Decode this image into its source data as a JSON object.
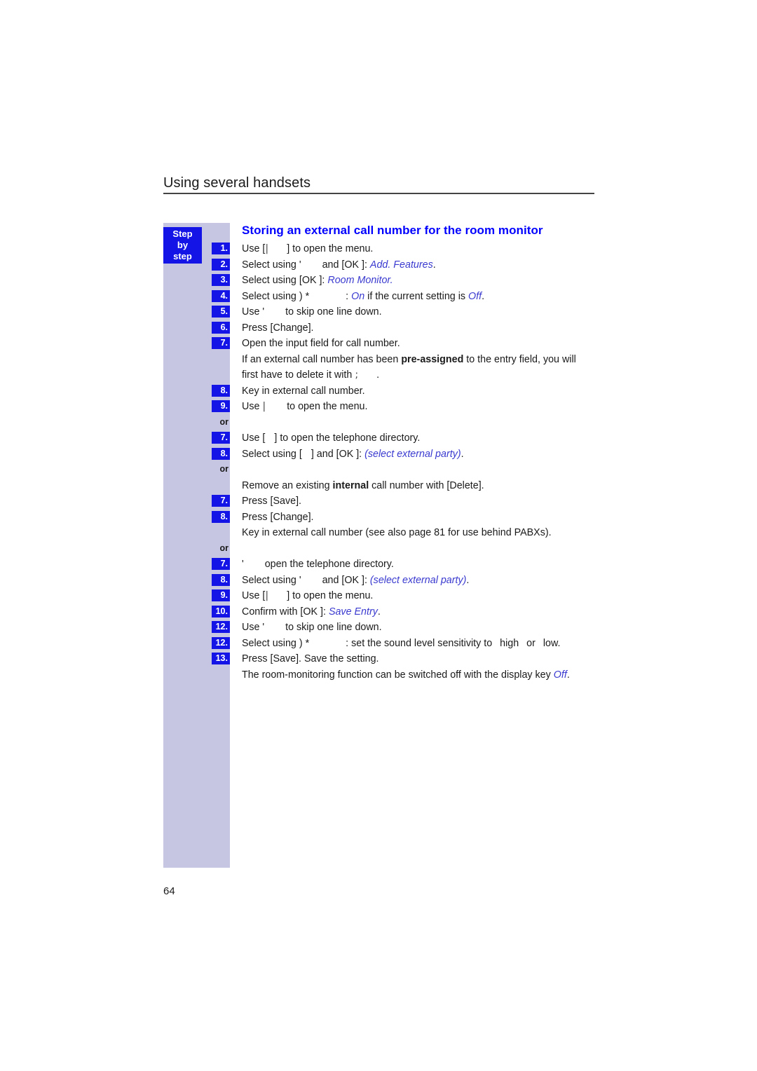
{
  "page": {
    "running_head": "Using several handsets",
    "folio": "64",
    "accent_blue": "#0000FF",
    "display_text_blue": "#3A3AD0",
    "rail_background": "#C6C6E2",
    "step_box_blue": "#1414E6"
  },
  "rail": {
    "badge_line1": "Step",
    "badge_line2": "by",
    "badge_line3": "step",
    "or_label": "or"
  },
  "section": {
    "heading": "Storing an external call number for the room monitor"
  },
  "steps": [
    {
      "marker": "1.",
      "type": "step",
      "parts": [
        {
          "t": "text",
          "v": "Use ["
        },
        {
          "t": "sym",
          "v": "|"
        },
        {
          "t": "gap",
          "v": ""
        },
        {
          "t": "text",
          "v": "] to open the menu."
        }
      ]
    },
    {
      "marker": "2.",
      "type": "step",
      "parts": [
        {
          "t": "text",
          "v": "Select using '"
        },
        {
          "t": "gap",
          "v": ""
        },
        {
          "t": "text",
          "v": " and [OK ]: "
        },
        {
          "t": "disp",
          "v": "Add. Features"
        },
        {
          "t": "text",
          "v": "."
        }
      ]
    },
    {
      "marker": "3.",
      "type": "step",
      "parts": [
        {
          "t": "text",
          "v": "Select using [OK ]: "
        },
        {
          "t": "disp",
          "v": "Room Monitor."
        }
      ]
    },
    {
      "marker": "4.",
      "type": "step",
      "parts": [
        {
          "t": "text",
          "v": "Select using ) *"
        },
        {
          "t": "gap2",
          "v": ""
        },
        {
          "t": "text",
          "v": ": "
        },
        {
          "t": "disp",
          "v": "On"
        },
        {
          "t": "text",
          "v": " if the current setting is "
        },
        {
          "t": "disp",
          "v": "Off"
        },
        {
          "t": "text",
          "v": "."
        }
      ]
    },
    {
      "marker": "5.",
      "type": "step",
      "parts": [
        {
          "t": "text",
          "v": "Use '"
        },
        {
          "t": "gap",
          "v": ""
        },
        {
          "t": "text",
          "v": " to skip one line down."
        }
      ]
    },
    {
      "marker": "6.",
      "type": "step",
      "parts": [
        {
          "t": "text",
          "v": "Press [Change]."
        }
      ]
    },
    {
      "marker": "7.",
      "type": "step",
      "parts": [
        {
          "t": "text",
          "v": "Open the input field for call number."
        }
      ]
    },
    {
      "marker": "",
      "type": "note",
      "parts": [
        {
          "t": "text",
          "v": "If an external call number has been "
        },
        {
          "t": "bold",
          "v": "pre-assigned"
        },
        {
          "t": "text",
          "v": " to the entry field, you will first have to delete it with "
        },
        {
          "t": "sym",
          "v": ";"
        },
        {
          "t": "gap",
          "v": ""
        },
        {
          "t": "text",
          "v": "."
        }
      ]
    },
    {
      "marker": "8.",
      "type": "step",
      "parts": [
        {
          "t": "text",
          "v": "Key in external call number."
        }
      ]
    },
    {
      "marker": "9.",
      "type": "step",
      "parts": [
        {
          "t": "text",
          "v": "Use "
        },
        {
          "t": "sym",
          "v": "|"
        },
        {
          "t": "gap",
          "v": ""
        },
        {
          "t": "text",
          "v": " to open the menu."
        }
      ]
    },
    {
      "marker": "or",
      "type": "or",
      "parts": []
    },
    {
      "marker": "7.",
      "type": "step",
      "parts": [
        {
          "t": "text",
          "v": "Use ["
        },
        {
          "t": "gap-s",
          "v": ""
        },
        {
          "t": "text",
          "v": "] to open the telephone directory."
        }
      ]
    },
    {
      "marker": "8.",
      "type": "step",
      "parts": [
        {
          "t": "text",
          "v": "Select using ["
        },
        {
          "t": "gap-s",
          "v": ""
        },
        {
          "t": "text",
          "v": "] and [OK ]: "
        },
        {
          "t": "disp",
          "v": "(select external party)"
        },
        {
          "t": "text",
          "v": "."
        }
      ]
    },
    {
      "marker": "or",
      "type": "or",
      "parts": []
    },
    {
      "marker": "",
      "type": "note",
      "parts": [
        {
          "t": "text",
          "v": "Remove an existing "
        },
        {
          "t": "bold",
          "v": "internal"
        },
        {
          "t": "text",
          "v": " call number with [Delete]."
        }
      ]
    },
    {
      "marker": "7.",
      "type": "step",
      "parts": [
        {
          "t": "text",
          "v": "Press [Save]."
        }
      ]
    },
    {
      "marker": "8.",
      "type": "step",
      "parts": [
        {
          "t": "text",
          "v": "Press [Change]."
        }
      ]
    },
    {
      "marker": "",
      "type": "note",
      "parts": [
        {
          "t": "text",
          "v": "Key in external call number (see also page 81 for use behind PABXs)."
        }
      ]
    },
    {
      "marker": "or",
      "type": "or",
      "parts": []
    },
    {
      "marker": "7.",
      "type": "step",
      "parts": [
        {
          "t": "text",
          "v": "'"
        },
        {
          "t": "gap",
          "v": ""
        },
        {
          "t": "text",
          "v": " open the telephone directory."
        }
      ]
    },
    {
      "marker": "8.",
      "type": "step",
      "parts": [
        {
          "t": "text",
          "v": "Select using '"
        },
        {
          "t": "gap",
          "v": ""
        },
        {
          "t": "text",
          "v": " and [OK ]: "
        },
        {
          "t": "disp",
          "v": "(select external party)"
        },
        {
          "t": "text",
          "v": "."
        }
      ]
    },
    {
      "marker": "9.",
      "type": "step",
      "parts": [
        {
          "t": "text",
          "v": "Use ["
        },
        {
          "t": "sym",
          "v": "|"
        },
        {
          "t": "gap",
          "v": ""
        },
        {
          "t": "text",
          "v": "] to open the menu."
        }
      ]
    },
    {
      "marker": "10.",
      "type": "step",
      "parts": [
        {
          "t": "text",
          "v": "Confirm with [OK ]: "
        },
        {
          "t": "disp",
          "v": "Save Entry"
        },
        {
          "t": "text",
          "v": "."
        }
      ]
    },
    {
      "marker": "12.",
      "type": "step",
      "parts": [
        {
          "t": "text",
          "v": "Use '"
        },
        {
          "t": "gap",
          "v": ""
        },
        {
          "t": "text",
          "v": " to skip one line down."
        }
      ]
    },
    {
      "marker": "12.",
      "type": "step",
      "parts": [
        {
          "t": "text",
          "v": "Select using ) *"
        },
        {
          "t": "gap2",
          "v": ""
        },
        {
          "t": "text",
          "v": ": set the sound level sensitivity to "
        },
        {
          "t": "gap-xs",
          "v": ""
        },
        {
          "t": "text",
          "v": "high "
        },
        {
          "t": "gap-xs",
          "v": ""
        },
        {
          "t": "text",
          "v": "or "
        },
        {
          "t": "gap-xs",
          "v": ""
        },
        {
          "t": "text",
          "v": "low."
        }
      ]
    },
    {
      "marker": "13.",
      "type": "step",
      "parts": [
        {
          "t": "text",
          "v": "Press [Save]. Save the setting."
        }
      ]
    },
    {
      "marker": "",
      "type": "note",
      "parts": [
        {
          "t": "text",
          "v": "The room-monitoring function can be switched off with the display key "
        },
        {
          "t": "disp",
          "v": "Off"
        },
        {
          "t": "text",
          "v": "."
        }
      ]
    }
  ]
}
